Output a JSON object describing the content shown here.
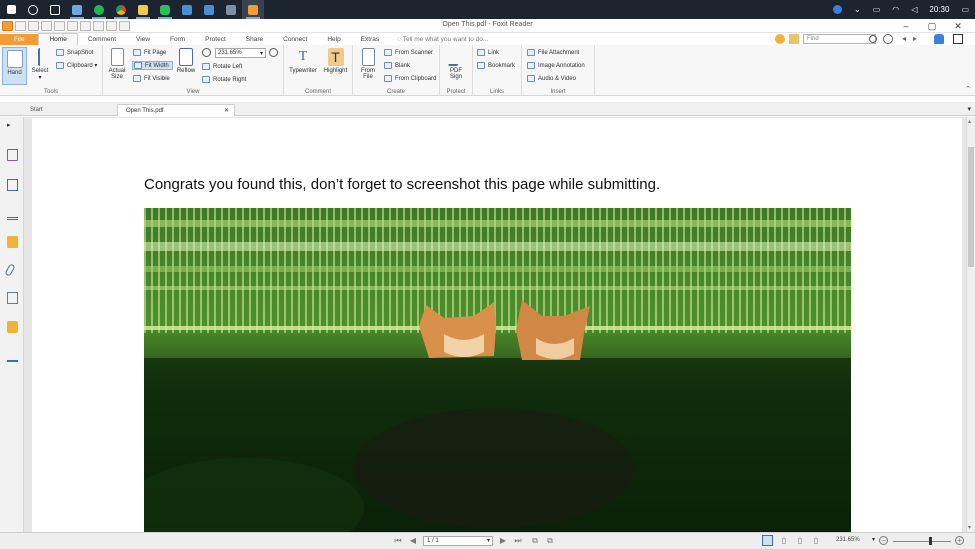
{
  "taskbar": {
    "apps": [
      {
        "name": "start-icon",
        "color": "#ffffff"
      },
      {
        "name": "search-icon",
        "color": "#ffffff"
      },
      {
        "name": "task-view-icon",
        "color": "#ffffff"
      },
      {
        "name": "mail-icon",
        "color": "#6fa8dc"
      },
      {
        "name": "spotify-icon",
        "color": "#1db954"
      },
      {
        "name": "chrome-icon",
        "color": "#e8b13a"
      },
      {
        "name": "file-explorer-icon",
        "color": "#f2c94c"
      },
      {
        "name": "line-icon",
        "color": "#27c05a"
      },
      {
        "name": "app-icon",
        "color": "#4a8fd6"
      },
      {
        "name": "app-icon-2",
        "color": "#4a8fd6"
      },
      {
        "name": "app-icon-3",
        "color": "#7a8fa8"
      },
      {
        "name": "foxit-icon",
        "color": "#f39c35"
      }
    ],
    "clock": "20:30"
  },
  "window": {
    "title": "Open This.pdf - Foxit Reader",
    "controls": [
      "–",
      "▢",
      "✕"
    ]
  },
  "menu": {
    "tabs": [
      "File",
      "Home",
      "Comment",
      "View",
      "Form",
      "Protect",
      "Share",
      "Connect",
      "Help",
      "Extras"
    ],
    "tell_me": "Tell me what you want to do...",
    "find_placeholder": "Find"
  },
  "ribbon": {
    "tools": {
      "label": "Tools",
      "hand": "Hand",
      "select": "Select",
      "snapshot": "SnapShot",
      "clipboard": "Clipboard"
    },
    "view": {
      "label": "View",
      "actual_size": "Actual\nSize",
      "fit_page": "Fit Page",
      "fit_width": "Fit Width",
      "fit_visible": "Fit Visible",
      "reflow": "Reflow",
      "zoom_value": "231.65%",
      "rotate_left": "Rotate Left",
      "rotate_right": "Rotate Right"
    },
    "comment": {
      "label": "Comment",
      "typewriter": "Typewriter",
      "highlight": "Highlight"
    },
    "create": {
      "label": "Create",
      "from_file": "From\nFile",
      "from_scanner": "From Scanner",
      "blank": "Blank",
      "from_clipboard": "From Clipboard"
    },
    "protect": {
      "label": "Protect",
      "pdf_sign": "PDF\nSign"
    },
    "links": {
      "label": "Links",
      "link": "Link",
      "bookmark": "Bookmark"
    },
    "insert": {
      "label": "Insert",
      "file_attachment": "File Attachment",
      "image_annotation": "Image Annotation",
      "audio_video": "Audio & Video"
    }
  },
  "doc_tabs": {
    "start": "Start",
    "active": "Open This.pdf",
    "close": "✕"
  },
  "document": {
    "heading": "Congrats you found this, don’t forget to screenshot this page while submitting."
  },
  "statusbar": {
    "page": "1 / 1",
    "zoom": "231.65%"
  },
  "colors": {
    "accent": "#f39c35",
    "ribbon_bg": "#f7f7f7",
    "taskbar_bg": "#1c2430"
  }
}
